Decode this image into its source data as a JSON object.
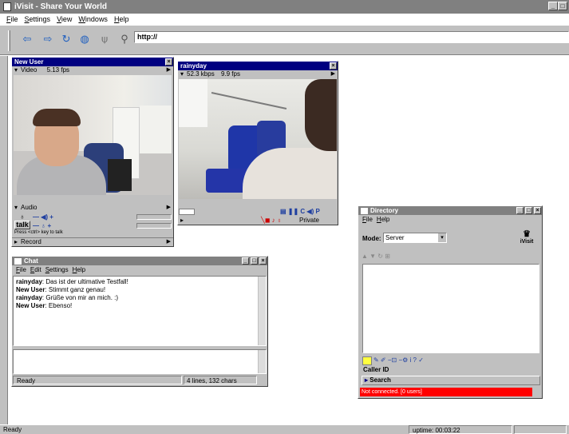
{
  "app": {
    "title": "iVisit - Share Your World",
    "menu": [
      "File",
      "Settings",
      "View",
      "Windows",
      "Help"
    ],
    "address": "http://",
    "status": "Ready",
    "uptime": "uptime: 00:03:22"
  },
  "colors": {
    "title_active": "#000080",
    "title_inactive": "#808080",
    "face": "#c0c0c0",
    "status_red": "#ff0000"
  },
  "new_user": {
    "title": "New User",
    "video_label": "Video",
    "video_fps": "5.13 fps",
    "audio_label": "Audio",
    "talk_label": "talk",
    "hint": "Press <ctrl> key to talk",
    "record_label": "Record"
  },
  "rainyday": {
    "title": "rainyday",
    "rate": "52.3 kbps",
    "fps": "9.9 fps",
    "private_label": "Private"
  },
  "chat": {
    "title": "Chat",
    "menu": [
      "File",
      "Edit",
      "Settings",
      "Help"
    ],
    "messages": [
      {
        "user": "rainyday",
        "text": ": Das ist der ultimative Testfall!"
      },
      {
        "user": "New User",
        "text": ": Stimmt ganz genau!"
      },
      {
        "user": "rainyday",
        "text": ": Grüße von mir an mich. :)"
      },
      {
        "user": "New User",
        "text": ": Ebenso!"
      }
    ],
    "status": "Ready",
    "stats": "4 lines, 132 chars"
  },
  "directory": {
    "title": "Directory",
    "menu": [
      "File",
      "Help"
    ],
    "mode_label": "Mode:",
    "mode_value": "Server",
    "logo_text": "iVisit",
    "caller_id": "Caller ID",
    "search": "Search",
    "status": "Not connected. [0 users]"
  }
}
